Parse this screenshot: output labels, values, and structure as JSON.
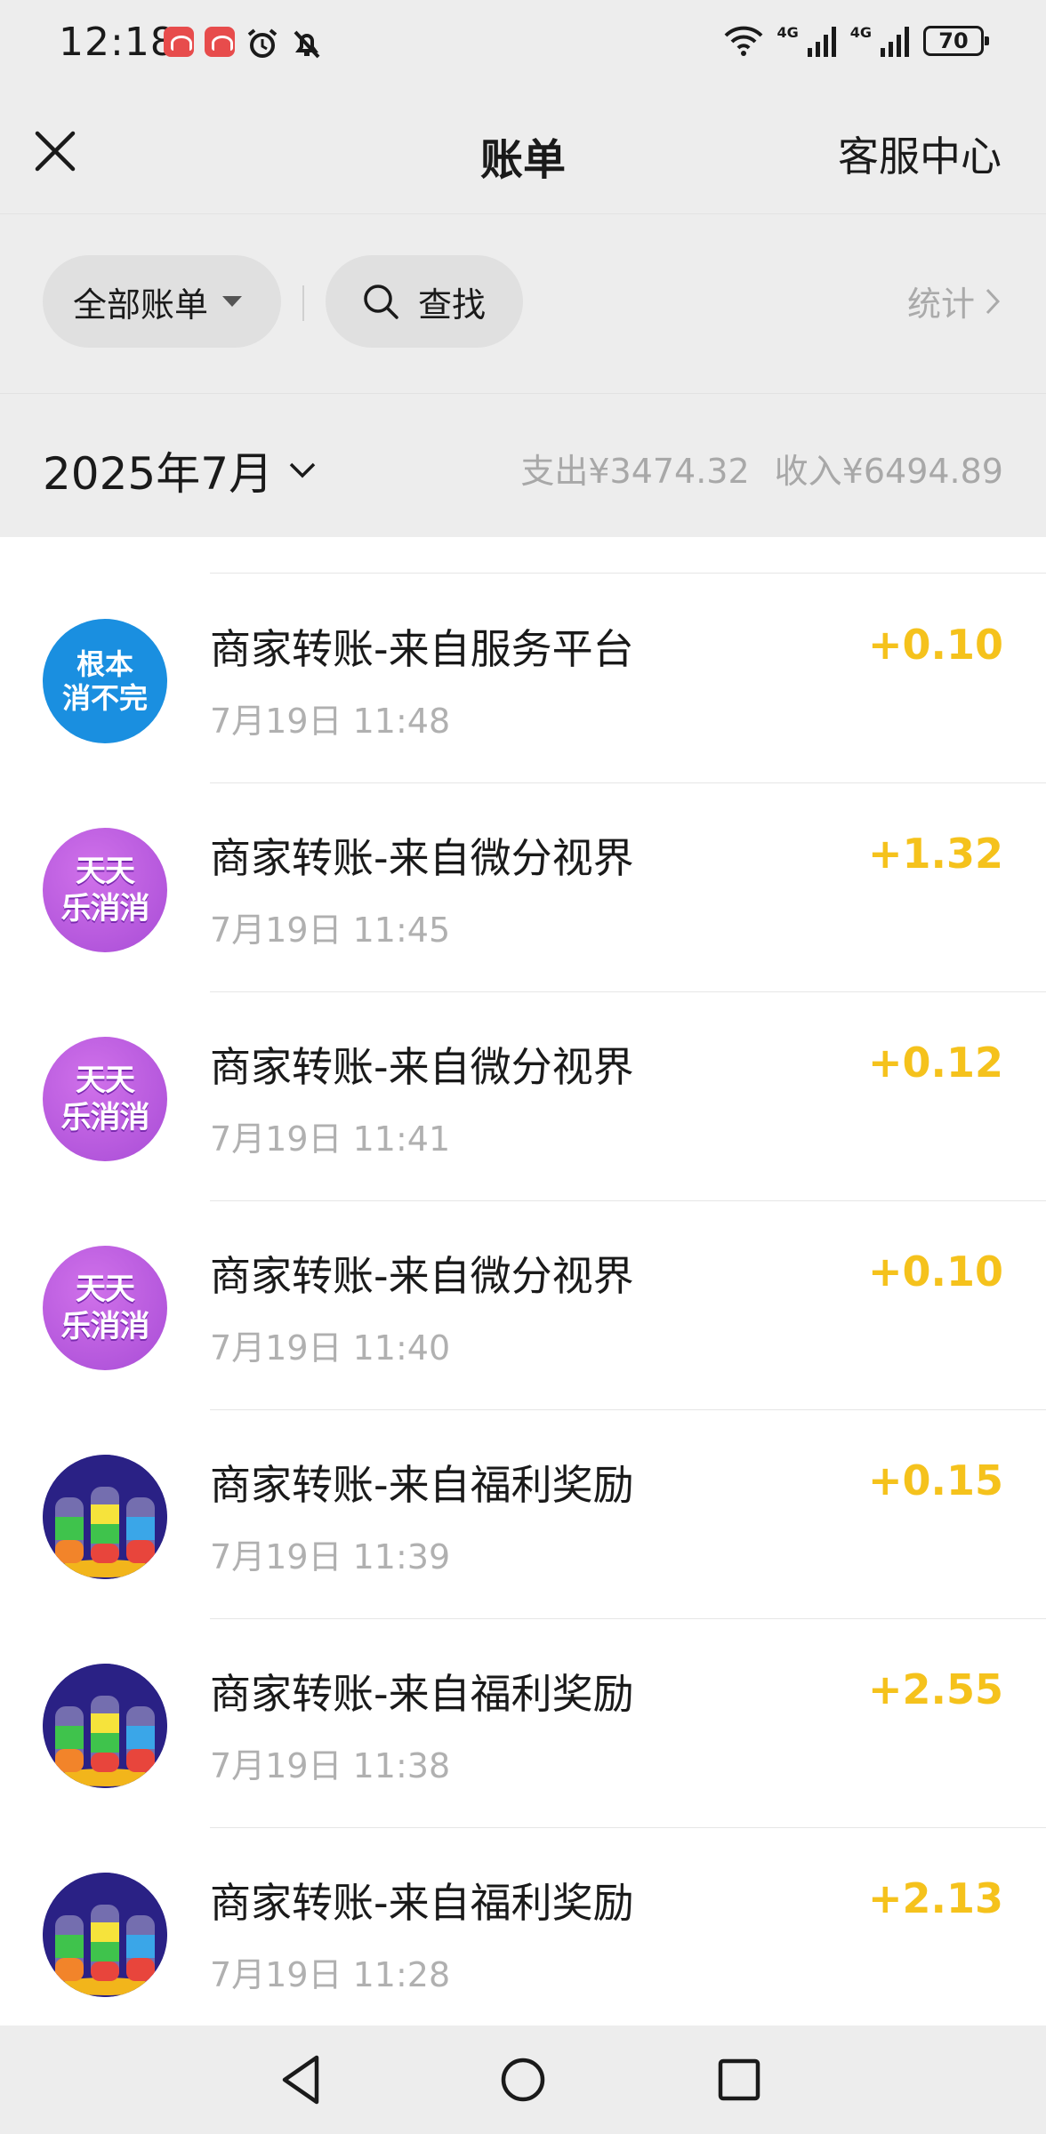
{
  "status_bar": {
    "time": "12:18",
    "signal_1": "4G",
    "signal_2": "4G",
    "battery": "70"
  },
  "nav": {
    "title": "账单",
    "service": "客服中心"
  },
  "filters": {
    "all_bills": "全部账单",
    "search": "查找",
    "stats": "统计"
  },
  "month": {
    "label": "2025年7月",
    "expense": "支出¥3474.32",
    "income": "收入¥6494.89"
  },
  "transactions": [
    {
      "title": "商家转账-来自服务平台",
      "time": "7月19日 11:48",
      "amount": "+0.10",
      "icon": "root-clear-app-icon",
      "icon_text": [
        "根本",
        "消不完"
      ]
    },
    {
      "title": "商家转账-来自微分视界",
      "time": "7月19日 11:45",
      "amount": "+1.32",
      "icon": "daily-match-app-icon",
      "icon_text": [
        "天天",
        "乐消消"
      ]
    },
    {
      "title": "商家转账-来自微分视界",
      "time": "7月19日 11:41",
      "amount": "+0.12",
      "icon": "daily-match-app-icon",
      "icon_text": [
        "天天",
        "乐消消"
      ]
    },
    {
      "title": "商家转账-来自微分视界",
      "time": "7月19日 11:40",
      "amount": "+0.10",
      "icon": "daily-match-app-icon",
      "icon_text": [
        "天天",
        "乐消消"
      ]
    },
    {
      "title": "商家转账-来自福利奖励",
      "time": "7月19日 11:39",
      "amount": "+0.15",
      "icon": "water-sort-game-icon"
    },
    {
      "title": "商家转账-来自福利奖励",
      "time": "7月19日 11:38",
      "amount": "+2.55",
      "icon": "water-sort-game-icon"
    },
    {
      "title": "商家转账-来自福利奖励",
      "time": "7月19日 11:28",
      "amount": "+2.13",
      "icon": "water-sort-game-icon"
    }
  ],
  "colors": {
    "amount": "#f5c21c",
    "background": "#ededed",
    "blue_icon": "#1a8fe0",
    "purple_icon": "#b95ee0"
  }
}
